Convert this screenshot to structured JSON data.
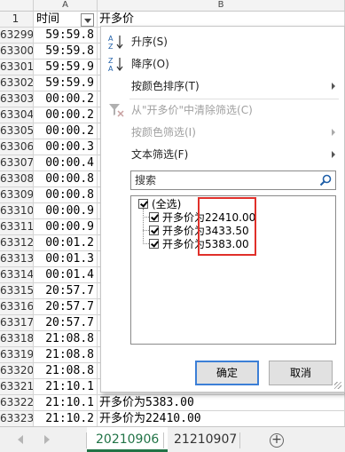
{
  "sheet": {
    "column_headers": [
      "A",
      "B"
    ],
    "header_row": {
      "row_num": "1",
      "col_a": "时间",
      "col_b": "开多价"
    },
    "rows": [
      {
        "row_num": "63299",
        "time": "59:59.8"
      },
      {
        "row_num": "63300",
        "time": "59:59.8"
      },
      {
        "row_num": "63301",
        "time": "59:59.9"
      },
      {
        "row_num": "63302",
        "time": "59:59.9"
      },
      {
        "row_num": "63303",
        "time": "00:00.2"
      },
      {
        "row_num": "63304",
        "time": "00:00.2"
      },
      {
        "row_num": "63305",
        "time": "00:00.2"
      },
      {
        "row_num": "63306",
        "time": "00:00.3"
      },
      {
        "row_num": "63307",
        "time": "00:00.4"
      },
      {
        "row_num": "63308",
        "time": "00:00.8"
      },
      {
        "row_num": "63309",
        "time": "00:00.8"
      },
      {
        "row_num": "63310",
        "time": "00:00.9"
      },
      {
        "row_num": "63311",
        "time": "00:00.9"
      },
      {
        "row_num": "63312",
        "time": "00:01.2"
      },
      {
        "row_num": "63313",
        "time": "00:01.3"
      },
      {
        "row_num": "63314",
        "time": "00:01.4"
      },
      {
        "row_num": "63315",
        "time": "20:57.7"
      },
      {
        "row_num": "63316",
        "time": "20:57.7"
      },
      {
        "row_num": "63317",
        "time": "20:57.7"
      },
      {
        "row_num": "63318",
        "time": "21:08.8"
      },
      {
        "row_num": "63319",
        "time": "21:08.8"
      },
      {
        "row_num": "63320",
        "time": "21:08.8"
      },
      {
        "row_num": "63321",
        "time": "21:10.1"
      },
      {
        "row_num": "63322",
        "time": "21:10.1",
        "value": "开多价为5383.00"
      },
      {
        "row_num": "63323",
        "time": "21:10.2",
        "value": "开多价为22410.00"
      }
    ]
  },
  "tabs": {
    "sheets": [
      "20210906",
      "21210907"
    ],
    "active": "20210906"
  },
  "filter_menu": {
    "items": [
      {
        "label": "升序(S)",
        "icon": "sort-ascending-icon",
        "enabled": true
      },
      {
        "label": "降序(O)",
        "icon": "sort-descending-icon",
        "enabled": true
      },
      {
        "label": "按颜色排序(T)",
        "enabled": true,
        "submenu": true
      },
      {
        "label": "从\"开多价\"中清除筛选(C)",
        "icon": "clear-filter-icon",
        "enabled": false
      },
      {
        "label": "按颜色筛选(I)",
        "enabled": false,
        "submenu": true
      },
      {
        "label": "文本筛选(F)",
        "enabled": true,
        "submenu": true
      }
    ],
    "search_placeholder": "搜索",
    "values": [
      {
        "label": "(全选)",
        "checked": true
      },
      {
        "label": "开多价为22410.00",
        "checked": true
      },
      {
        "label": "开多价为3433.50",
        "checked": true
      },
      {
        "label": "开多价为5383.00",
        "checked": true
      }
    ],
    "ok_label": "确定",
    "cancel_label": "取消"
  },
  "colors": {
    "accent_green": "#217346",
    "highlight_red": "#e0302a",
    "primary_border": "#3c7fd6"
  }
}
